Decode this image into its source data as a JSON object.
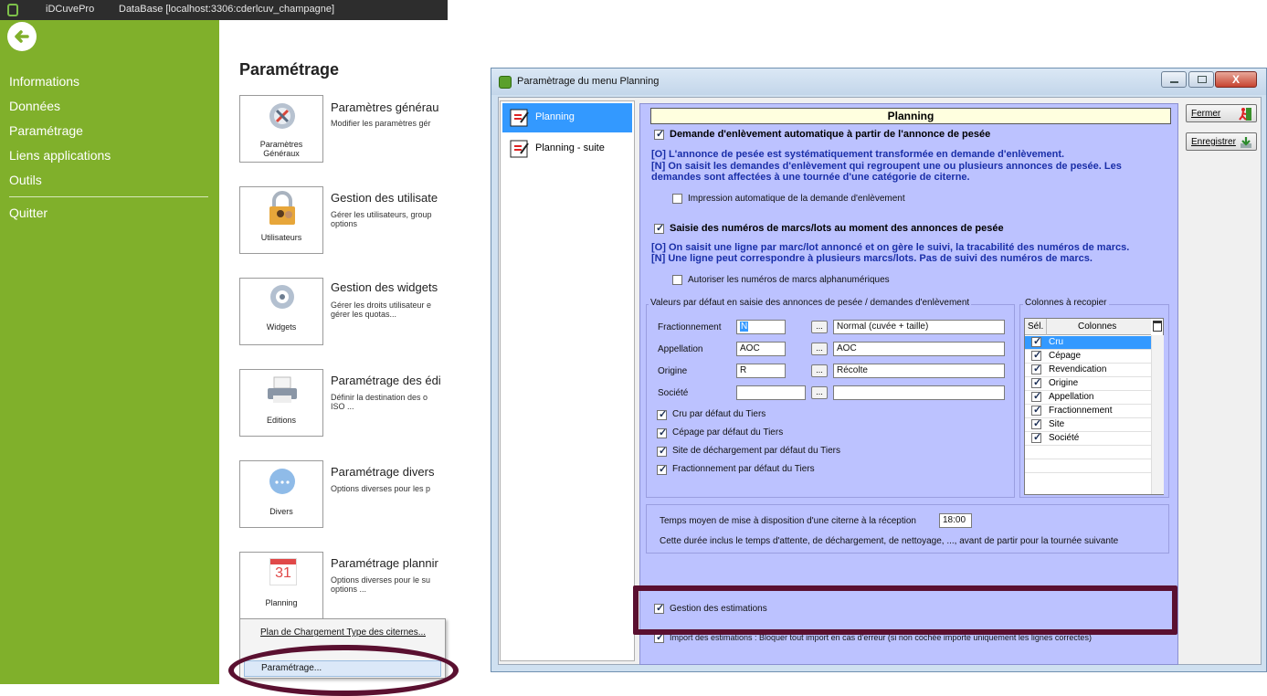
{
  "app": {
    "name": "iDCuvePro",
    "database": "DataBase [localhost:3306:cderlcuv_champagne]"
  },
  "sidebar": {
    "items": [
      {
        "label": "Informations"
      },
      {
        "label": "Données"
      },
      {
        "label": "Paramétrage"
      },
      {
        "label": "Liens applications"
      },
      {
        "label": "Outils"
      },
      {
        "label": "Quitter"
      }
    ]
  },
  "page": {
    "title": "Paramétrage",
    "tiles": [
      {
        "label": "Paramètres\nGénéraux",
        "heading": "Paramètres générau",
        "desc": "Modifier les paramètres gér",
        "icon": "settings-tools-icon"
      },
      {
        "label": "Utilisateurs",
        "heading": "Gestion des utilisate",
        "desc": "Gérer les utilisateurs, group\noptions",
        "icon": "users-lock-icon"
      },
      {
        "label": "Widgets",
        "heading": "Gestion des widgets",
        "desc": "Gérer les droits utilisateur e\ngérer les quotas...",
        "icon": "widget-gear-icon"
      },
      {
        "label": "Editions",
        "heading": "Paramétrage des édi",
        "desc": "Définir la destination des o\nISO ...",
        "icon": "printer-icon"
      },
      {
        "label": "Divers",
        "heading": "Paramétrage divers",
        "desc": "Options diverses pour les p",
        "icon": "bubble-icon"
      },
      {
        "label": "Planning",
        "heading": "Paramétrage plannir",
        "desc": "Options diverses pour le su\noptions ...",
        "icon": "calendar-icon",
        "day": "31"
      }
    ]
  },
  "context_menu": {
    "items": [
      {
        "label": "Plan de Chargement Type des citernes..."
      },
      {
        "label": "..."
      },
      {
        "label": "Paramétrage..."
      }
    ]
  },
  "dialog": {
    "title": "Paramètrage du menu Planning",
    "close_glyph": "X",
    "nav": [
      {
        "label": "Planning",
        "selected": true
      },
      {
        "label": "Planning - suite",
        "selected": false
      }
    ],
    "header": "Planning",
    "auto_removal": {
      "label": "Demande d'enlèvement automatique à partir de l'annonce de pesée",
      "checked": true,
      "help1": "[O] L'annonce de pesée est systématiquement transformée en demande d'enlèvement.",
      "help2": "[N] On saisit les demandes d'enlèvement qui regroupent une ou plusieurs annonces de pesée. Les",
      "help3": "demandes sont affectées à une tournée d'une catégorie de citerne.",
      "print_label": "Impression automatique de la demande d'enlèvement",
      "print_checked": false
    },
    "lots": {
      "label": "Saisie des numéros de marcs/lots au moment des annonces de pesée",
      "checked": true,
      "help1": "[O] On saisit une ligne par marc/lot annoncé et on gère le suivi, la tracabilité des numéros de marcs.",
      "help2": "[N] Une ligne peut correspondre à plusieurs marcs/lots. Pas de suivi des numéros de marcs.",
      "alpha_label": "Autoriser les numéros de marcs alphanumériques",
      "alpha_checked": false
    },
    "defaults": {
      "group_label": "Valeurs par défaut en saisie des annonces de pesée / demandes d'enlèvement",
      "fields": [
        {
          "label": "Fractionnement",
          "code": "N",
          "desc": "Normal (cuvée + taille)"
        },
        {
          "label": "Appellation",
          "code": "AOC",
          "desc": "AOC"
        },
        {
          "label": "Origine",
          "code": "R",
          "desc": "Récolte"
        },
        {
          "label": "Société",
          "code": "",
          "desc": ""
        }
      ],
      "dots": "...",
      "checks": [
        {
          "label": "Cru par défaut du Tiers",
          "checked": true
        },
        {
          "label": "Cépage par défaut du Tiers",
          "checked": true
        },
        {
          "label": "Site de déchargement par défaut du Tiers",
          "checked": true
        },
        {
          "label": "Fractionnement par défaut du Tiers",
          "checked": true
        }
      ]
    },
    "columns": {
      "group_label": "Colonnes à recopier",
      "headers": {
        "sel": "Sél.",
        "name": "Colonnes"
      },
      "rows": [
        {
          "name": "Cru",
          "checked": true,
          "selected": true
        },
        {
          "name": "Cépage",
          "checked": true,
          "selected": false
        },
        {
          "name": "Revendication",
          "checked": true,
          "selected": false
        },
        {
          "name": "Origine",
          "checked": true,
          "selected": false
        },
        {
          "name": "Appellation",
          "checked": true,
          "selected": false
        },
        {
          "name": "Fractionnement",
          "checked": true,
          "selected": false
        },
        {
          "name": "Site",
          "checked": true,
          "selected": false
        },
        {
          "name": "Société",
          "checked": true,
          "selected": false
        }
      ]
    },
    "tank_time": {
      "label": "Temps moyen de mise à disposition d'une citerne à la réception",
      "value": "18:00",
      "note": "Cette durée inclus le temps d'attente, de déchargement, de nettoyage, ..., avant de partir pour la tournée suivante"
    },
    "estimates": {
      "label": "Gestion des estimations",
      "checked": true,
      "import_label": "Import des estimations : Bloquer tout import en cas d'erreur (si non cochée importe uniquement les lignes correctes)"
    },
    "buttons": {
      "close": "Fermer",
      "save": "Enregistrer"
    }
  },
  "colors": {
    "sidebar": "#80b02b",
    "panel": "#bcc2ff",
    "highlight": "#5a1030",
    "selection": "#3399ff"
  }
}
